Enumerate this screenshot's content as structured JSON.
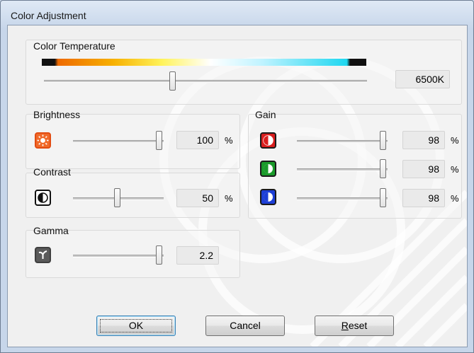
{
  "window": {
    "title": "Color Adjustment"
  },
  "color_temperature": {
    "label": "Color Temperature",
    "value": "6500K",
    "slider_level": 0.41
  },
  "brightness": {
    "label": "Brightness",
    "value": "100",
    "unit": "%",
    "slider_level": 1.0,
    "icon": "sun-icon",
    "accent": "#f06a2a"
  },
  "contrast": {
    "label": "Contrast",
    "value": "50",
    "unit": "%",
    "slider_level": 0.5,
    "icon": "contrast-icon"
  },
  "gamma": {
    "label": "Gamma",
    "value": "2.2",
    "slider_level": 1.0,
    "icon": "gamma-icon"
  },
  "gain": {
    "label": "Gain",
    "channels": [
      {
        "name": "red",
        "value": "98",
        "unit": "%",
        "slider_level": 0.98,
        "color": "#d81e1e",
        "icon": "red-gain-icon"
      },
      {
        "name": "green",
        "value": "98",
        "unit": "%",
        "slider_level": 0.98,
        "color": "#1a9a2a",
        "icon": "green-gain-icon"
      },
      {
        "name": "blue",
        "value": "98",
        "unit": "%",
        "slider_level": 0.98,
        "color": "#1d3fd6",
        "icon": "blue-gain-icon"
      }
    ]
  },
  "buttons": {
    "ok": "OK",
    "cancel": "Cancel",
    "reset": "Reset"
  }
}
